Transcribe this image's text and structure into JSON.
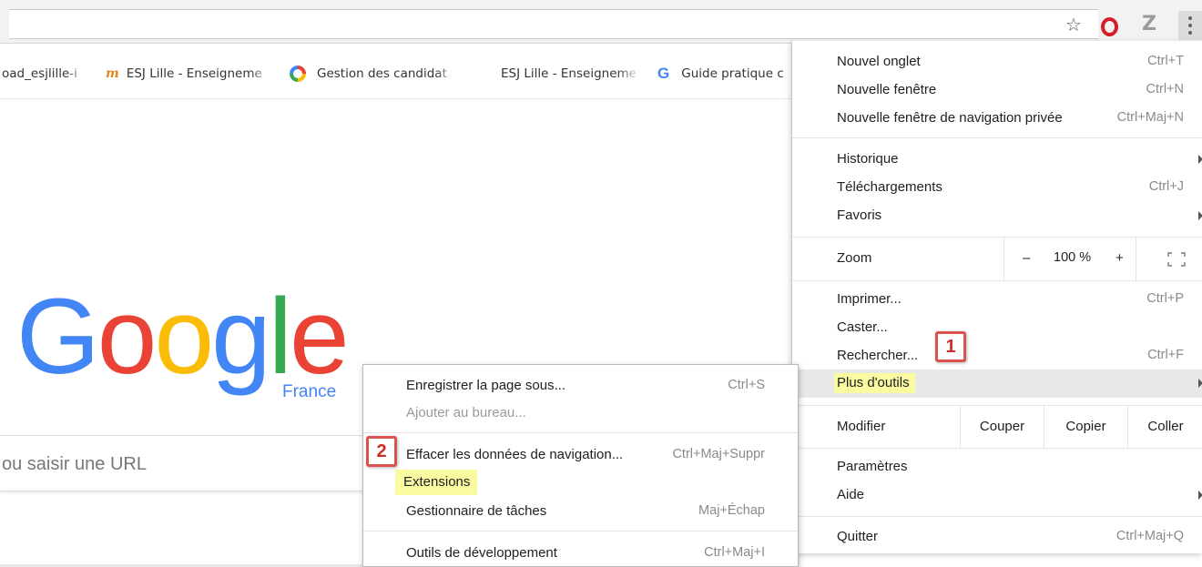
{
  "bookmarks": [
    {
      "label": "oad_esjlille-i",
      "icon": "none"
    },
    {
      "label": "ESJ Lille - Enseigneme",
      "icon": "moodle-icon"
    },
    {
      "label": "Gestion des candidat",
      "icon": "ring-icon"
    },
    {
      "label": "ESJ Lille - Enseigneme",
      "icon": "none"
    },
    {
      "label": "Guide pratique c",
      "icon": "google-g-icon"
    }
  ],
  "logo": {
    "letters": [
      "G",
      "o",
      "o",
      "g",
      "l",
      "e"
    ],
    "region": "France",
    "colors": {
      "blue": "#4285f4",
      "red": "#ea4335",
      "yellow": "#fbbc05",
      "green": "#34a853"
    }
  },
  "search": {
    "text": "ou saisir une URL"
  },
  "menu": {
    "items": [
      {
        "label": "Nouvel onglet",
        "shortcut": "Ctrl+T"
      },
      {
        "label": "Nouvelle fenêtre",
        "shortcut": "Ctrl+N"
      },
      {
        "label": "Nouvelle fenêtre de navigation privée",
        "shortcut": "Ctrl+Maj+N"
      },
      {
        "label": "Historique",
        "shortcut": ""
      },
      {
        "label": "Téléchargements",
        "shortcut": "Ctrl+J"
      },
      {
        "label": "Favoris",
        "shortcut": ""
      },
      {
        "label": "Imprimer...",
        "shortcut": "Ctrl+P"
      },
      {
        "label": "Caster...",
        "shortcut": ""
      },
      {
        "label": "Rechercher...",
        "shortcut": "Ctrl+F"
      },
      {
        "label": "Plus d'outils",
        "shortcut": ""
      },
      {
        "label": "Paramètres",
        "shortcut": ""
      },
      {
        "label": "Aide",
        "shortcut": ""
      },
      {
        "label": "Quitter",
        "shortcut": "Ctrl+Maj+Q"
      }
    ],
    "zoom": {
      "label": "Zoom",
      "minus": "–",
      "value": "100 %",
      "plus": "+"
    },
    "edit": {
      "label": "Modifier",
      "cut": "Couper",
      "copy": "Copier",
      "paste": "Coller"
    }
  },
  "submenu": {
    "items": [
      {
        "label": "Enregistrer la page sous...",
        "shortcut": "Ctrl+S"
      },
      {
        "label": "Ajouter au bureau...",
        "shortcut": ""
      },
      {
        "label": "Effacer les données de navigation...",
        "shortcut": "Ctrl+Maj+Suppr"
      },
      {
        "label": "Extensions",
        "shortcut": ""
      },
      {
        "label": "Gestionnaire de tâches",
        "shortcut": "Maj+Échap"
      },
      {
        "label": "Outils de développement",
        "shortcut": "Ctrl+Maj+I"
      }
    ]
  },
  "callouts": [
    "1",
    "2"
  ],
  "colors": {
    "highlight": "#fafaa0",
    "callout": "#d9534f",
    "hover": "#e8e8e8"
  }
}
